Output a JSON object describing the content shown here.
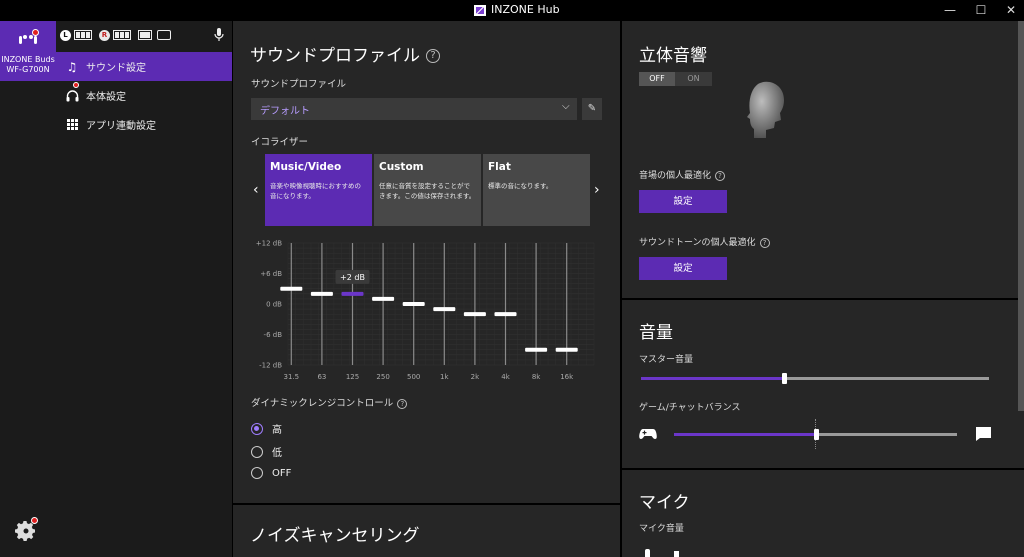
{
  "window": {
    "title": "INZONE Hub",
    "minimize": "—",
    "maximize": "☐",
    "close": "✕"
  },
  "device": {
    "name_line1": "INZONE Buds",
    "name_line2": "WF-G700N"
  },
  "status": {
    "left_label": "L",
    "right_label": "R"
  },
  "nav": {
    "items": [
      {
        "label": "サウンド設定",
        "icon": "music-note-icon",
        "active": true
      },
      {
        "label": "本体設定",
        "icon": "headset-icon",
        "active": false
      },
      {
        "label": "アプリ連動設定",
        "icon": "grid-icon",
        "active": false
      }
    ]
  },
  "sound_profile": {
    "heading": "サウンドプロファイル",
    "help": "?",
    "field_label": "サウンドプロファイル",
    "selected": "デフォルト",
    "eq_label": "イコライザー",
    "presets": [
      {
        "title": "Music/Video",
        "desc": "音楽や映像視聴時におすすめの音になります。",
        "selected": true
      },
      {
        "title": "Custom",
        "desc": "任意に音質を設定することができます。この値は保存されます。",
        "selected": false
      },
      {
        "title": "Flat",
        "desc": "標準の音になります。",
        "selected": false
      }
    ],
    "prev_arrow": "‹",
    "next_arrow": "›",
    "dynamic_range_label": "ダイナミックレンジコントロール",
    "dynamic_range_options": [
      "高",
      "低",
      "OFF"
    ],
    "dynamic_range_selected": 0
  },
  "chart_data": {
    "type": "bar",
    "categories": [
      "31.5",
      "63",
      "125",
      "250",
      "500",
      "1k",
      "2k",
      "4k",
      "8k",
      "16k"
    ],
    "y_tick_labels": [
      "+12 dB",
      "+6 dB",
      "0 dB",
      "-6 dB",
      "-12 dB"
    ],
    "ylim": [
      -12,
      12
    ],
    "values": [
      3,
      2,
      2,
      1,
      0,
      -1,
      -2,
      -2,
      -9,
      -9
    ],
    "highlight_index": 2,
    "tooltip": "+2 dB",
    "grid": true,
    "colors": {
      "handle": "#ffffff",
      "active_handle": "#6b36c9"
    }
  },
  "noise_cancel": {
    "heading": "ノイズキャンセリング"
  },
  "spatial": {
    "heading": "立体音響",
    "toggle_off": "OFF",
    "toggle_on": "ON",
    "toggle_state": "OFF",
    "personal_label": "音場の個人最適化",
    "personal_button": "設定",
    "tone_label": "サウンドトーンの個人最適化",
    "tone_button": "設定"
  },
  "volume": {
    "heading": "音量",
    "master_label": "マスター音量",
    "master_value": 0.41,
    "balance_label": "ゲーム/チャットバランス",
    "balance_value": 0.5
  },
  "mic": {
    "heading": "マイク",
    "volume_label": "マイク音量"
  },
  "colors": {
    "accent": "#5c2bb3",
    "panel": "#262626",
    "sidebar": "#1b1b1b"
  }
}
